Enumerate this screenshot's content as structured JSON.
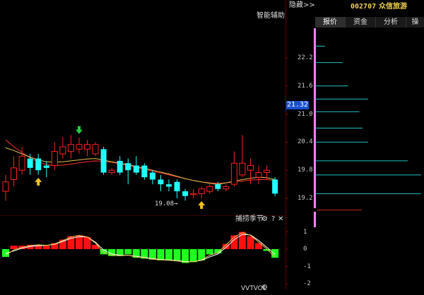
{
  "header": {
    "hide_label": "隐藏>>",
    "stock_code": "002707",
    "stock_name": "众信旅游"
  },
  "tabs": [
    {
      "label": "报价",
      "active": true
    },
    {
      "label": "资金",
      "active": false
    },
    {
      "label": "分析",
      "active": false
    },
    {
      "label": "操",
      "active": false
    }
  ],
  "main_chart": {
    "assist_label": "智能辅助",
    "low_label": "19.08",
    "current_price": "21.32",
    "price_ticks": [
      "22.2",
      "21.6",
      "21.0",
      "20.4",
      "19.8",
      "19.2"
    ]
  },
  "indicator": {
    "title": "捕捞季节",
    "help": "?",
    "close": "✕",
    "axis_ticks": [
      "1",
      "0",
      "-1",
      "-2"
    ],
    "next_title": "VVTVOL"
  },
  "colors": {
    "up": "#ff2020",
    "down": "#20ffff",
    "ma1": "#e0c050",
    "ma2": "#ff3030",
    "accent": "#ff80ff",
    "hist_up": "#ff1010",
    "hist_down": "#20ff20"
  },
  "chart_data": {
    "type": "candlestick",
    "price_axis": {
      "ticks": [
        22.2,
        21.6,
        21.0,
        20.4,
        19.8,
        19.2
      ],
      "current": 21.32,
      "labeled_low": 19.08
    },
    "candles": [
      {
        "o": 19.35,
        "c": 19.55,
        "h": 19.7,
        "l": 19.15
      },
      {
        "o": 19.6,
        "c": 19.85,
        "h": 20.1,
        "l": 19.45
      },
      {
        "o": 19.8,
        "c": 20.1,
        "h": 20.3,
        "l": 19.7
      },
      {
        "o": 20.05,
        "c": 19.85,
        "h": 20.15,
        "l": 19.7
      },
      {
        "o": 20.05,
        "c": 19.8,
        "h": 20.15,
        "l": 19.7
      },
      {
        "o": 19.9,
        "c": 19.85,
        "h": 20.0,
        "l": 19.65
      },
      {
        "o": 19.9,
        "c": 20.2,
        "h": 20.4,
        "l": 19.8
      },
      {
        "o": 20.15,
        "c": 20.3,
        "h": 20.5,
        "l": 20.05
      },
      {
        "o": 20.2,
        "c": 20.35,
        "h": 20.55,
        "l": 20.05
      },
      {
        "o": 20.25,
        "c": 20.35,
        "h": 20.5,
        "l": 20.15
      },
      {
        "o": 20.25,
        "c": 20.35,
        "h": 20.45,
        "l": 20.1
      },
      {
        "o": 20.15,
        "c": 20.35,
        "h": 20.4,
        "l": 20.1
      },
      {
        "o": 20.25,
        "c": 19.75,
        "h": 20.3,
        "l": 19.7
      },
      {
        "o": 19.75,
        "c": 19.8,
        "h": 19.85,
        "l": 19.7
      },
      {
        "o": 20.0,
        "c": 19.75,
        "h": 20.1,
        "l": 19.7
      },
      {
        "o": 19.95,
        "c": 19.8,
        "h": 20.05,
        "l": 19.5
      },
      {
        "o": 19.9,
        "c": 19.75,
        "h": 20.1,
        "l": 19.7
      },
      {
        "o": 19.9,
        "c": 19.65,
        "h": 19.95,
        "l": 19.6
      },
      {
        "o": 19.75,
        "c": 19.6,
        "h": 19.8,
        "l": 19.5
      },
      {
        "o": 19.6,
        "c": 19.5,
        "h": 19.7,
        "l": 19.35
      },
      {
        "o": 19.5,
        "c": 19.45,
        "h": 19.6,
        "l": 19.35
      },
      {
        "o": 19.55,
        "c": 19.35,
        "h": 19.6,
        "l": 19.2
      },
      {
        "o": 19.35,
        "c": 19.25,
        "h": 19.4,
        "l": 19.15
      },
      {
        "o": 19.3,
        "c": 19.3,
        "h": 19.4,
        "l": 19.2
      },
      {
        "o": 19.3,
        "c": 19.4,
        "h": 19.45,
        "l": 19.2
      },
      {
        "o": 19.35,
        "c": 19.45,
        "h": 19.5,
        "l": 19.3
      },
      {
        "o": 19.5,
        "c": 19.4,
        "h": 19.55,
        "l": 19.35
      },
      {
        "o": 19.4,
        "c": 19.45,
        "h": 19.5,
        "l": 19.35
      },
      {
        "o": 19.5,
        "c": 19.95,
        "h": 20.2,
        "l": 19.45
      },
      {
        "o": 19.7,
        "c": 19.95,
        "h": 20.55,
        "l": 19.65
      },
      {
        "o": 19.8,
        "c": 19.9,
        "h": 20.05,
        "l": 19.5
      },
      {
        "o": 19.65,
        "c": 19.75,
        "h": 19.9,
        "l": 19.5
      },
      {
        "o": 19.75,
        "c": 19.8,
        "h": 19.9,
        "l": 19.6
      },
      {
        "o": 19.6,
        "c": 19.3,
        "h": 19.65,
        "l": 19.25
      }
    ],
    "markers": [
      {
        "index": 4,
        "type": "buy"
      },
      {
        "index": 9,
        "type": "sell"
      },
      {
        "index": 24,
        "type": "buy"
      }
    ],
    "ma_fast": [
      20.28,
      20.22,
      20.15,
      20.08,
      20.02,
      19.98,
      19.97,
      19.98,
      20.0,
      20.02,
      20.04,
      20.05,
      20.02,
      19.98,
      19.95,
      19.92,
      19.88,
      19.84,
      19.8,
      19.76,
      19.72,
      19.67,
      19.62,
      19.58,
      19.55,
      19.52,
      19.5,
      19.53,
      19.57,
      19.6,
      19.63,
      19.65,
      19.64,
      19.6
    ],
    "ma_slow": [
      20.45,
      20.3,
      20.18,
      20.06,
      19.98,
      19.92,
      19.9,
      19.91,
      19.93,
      19.96,
      19.98,
      20.0,
      19.99,
      19.97,
      19.94,
      19.9,
      19.86,
      19.82,
      19.78,
      19.74,
      19.7,
      19.66,
      19.62,
      19.58,
      19.55,
      19.53,
      19.52,
      19.53,
      19.55,
      19.57,
      19.59,
      19.6,
      19.6,
      19.58
    ],
    "order_book": [
      {
        "price": 22.45,
        "value": 0.09
      },
      {
        "price": 22.1,
        "value": 0.25
      },
      {
        "price": 21.6,
        "value": 0.3
      },
      {
        "price": 21.32,
        "value": 0.48
      },
      {
        "price": 21.05,
        "value": 0.4
      },
      {
        "price": 20.7,
        "value": 0.43
      },
      {
        "price": 20.4,
        "value": 0.48
      },
      {
        "price": 20.0,
        "value": 0.84
      },
      {
        "price": 19.7,
        "value": 0.96
      },
      {
        "price": 19.3,
        "value": 0.96
      },
      {
        "price": 18.95,
        "value": 0.42
      }
    ],
    "indicator_hist": [
      -0.45,
      0.2,
      0.2,
      0.25,
      0.25,
      0.2,
      0.35,
      0.55,
      0.75,
      0.8,
      0.7,
      0.25,
      -0.3,
      -0.4,
      -0.4,
      -0.3,
      -0.5,
      -0.55,
      -0.6,
      -0.65,
      -0.65,
      -0.7,
      -0.8,
      -0.75,
      -0.65,
      -0.3,
      -0.25,
      0.3,
      0.8,
      1.0,
      0.75,
      0.35,
      -0.1,
      -0.5
    ],
    "indicator_line1": [
      -0.35,
      -0.05,
      0.1,
      0.2,
      0.25,
      0.22,
      0.3,
      0.5,
      0.7,
      0.8,
      0.7,
      0.35,
      -0.2,
      -0.35,
      -0.38,
      -0.35,
      -0.45,
      -0.5,
      -0.58,
      -0.62,
      -0.65,
      -0.68,
      -0.75,
      -0.72,
      -0.62,
      -0.35,
      -0.2,
      0.25,
      0.7,
      0.95,
      0.8,
      0.4,
      0.0,
      -0.45
    ],
    "indicator_line2": [
      -0.25,
      -0.1,
      0.05,
      0.15,
      0.2,
      0.22,
      0.28,
      0.45,
      0.62,
      0.72,
      0.7,
      0.4,
      -0.05,
      -0.28,
      -0.35,
      -0.35,
      -0.42,
      -0.48,
      -0.55,
      -0.6,
      -0.63,
      -0.66,
      -0.72,
      -0.72,
      -0.65,
      -0.45,
      -0.28,
      0.1,
      0.55,
      0.85,
      0.82,
      0.5,
      0.1,
      -0.3
    ]
  }
}
